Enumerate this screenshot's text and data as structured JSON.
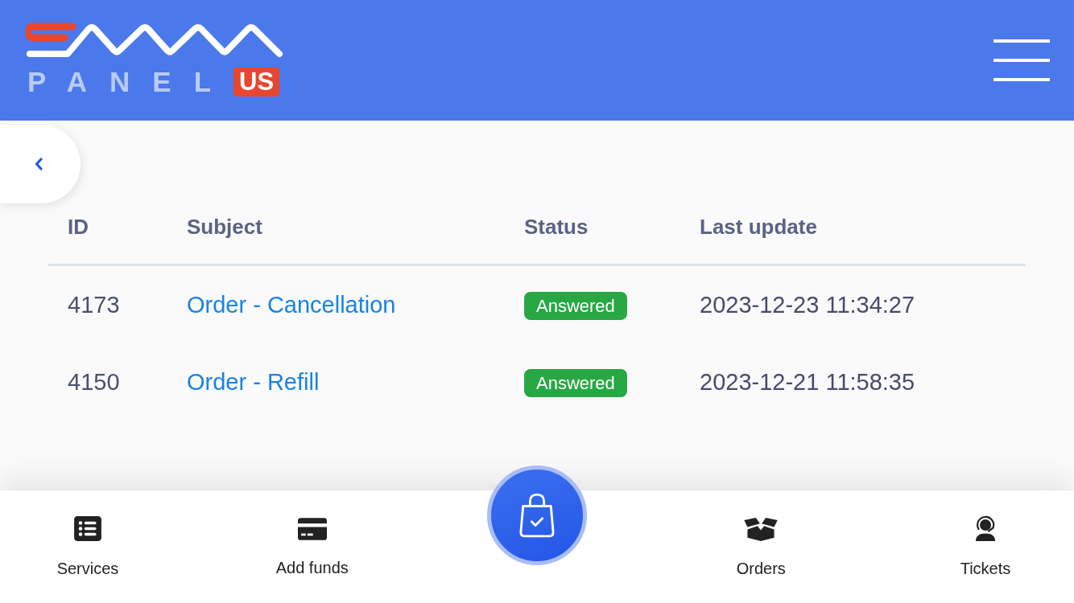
{
  "header": {
    "logo": {
      "word": "PANEL",
      "badge": "US"
    }
  },
  "table": {
    "columns": [
      "ID",
      "Subject",
      "Status",
      "Last update"
    ],
    "rows": [
      {
        "id": "4173",
        "subject": "Order - Cancellation",
        "status": "Answered",
        "last_update": "2023-12-23 11:34:27"
      },
      {
        "id": "4150",
        "subject": "Order - Refill",
        "status": "Answered",
        "last_update": "2023-12-21 11:58:35"
      }
    ]
  },
  "bottom_nav": {
    "items": [
      {
        "label": "Services"
      },
      {
        "label": "Add funds"
      },
      {
        "label": "Orders"
      },
      {
        "label": "Tickets"
      }
    ]
  }
}
